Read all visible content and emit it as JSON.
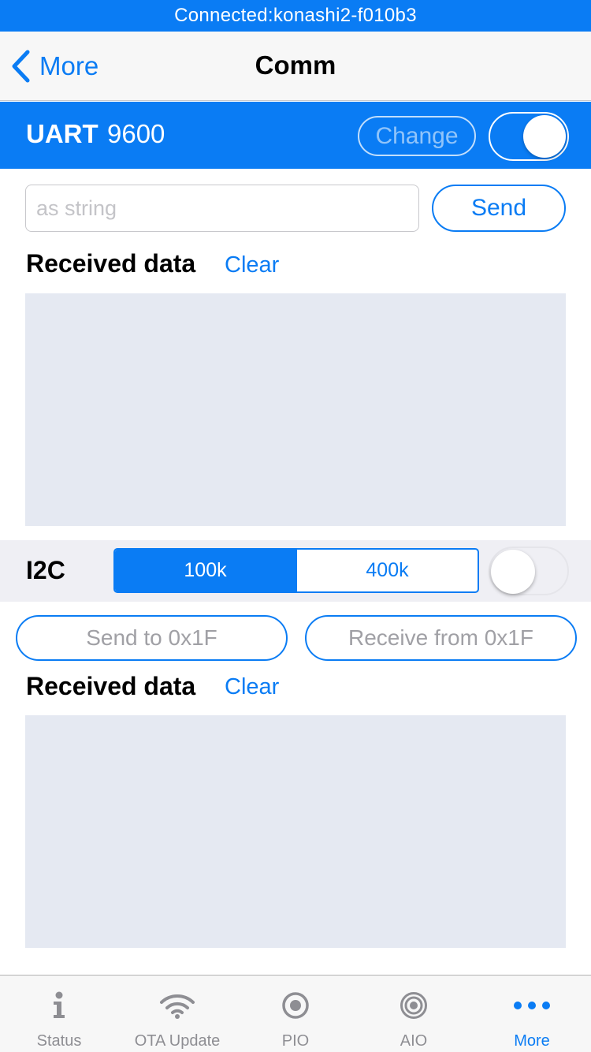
{
  "status_bar": {
    "text": "Connected:konashi2-f010b3"
  },
  "nav": {
    "back_label": "More",
    "title": "Comm"
  },
  "uart": {
    "label": "UART",
    "baud": "9600",
    "change_label": "Change",
    "enabled": true,
    "input_placeholder": "as string",
    "input_value": "",
    "send_label": "Send",
    "received_heading": "Received data",
    "clear_label": "Clear",
    "received_text": ""
  },
  "i2c": {
    "label": "I2C",
    "speeds": [
      "100k",
      "400k"
    ],
    "selected_speed": "100k",
    "enabled": false,
    "send_label": "Send to 0x1F",
    "receive_label": "Receive from 0x1F",
    "received_heading": "Received data",
    "clear_label": "Clear",
    "received_text": ""
  },
  "tabs": [
    {
      "label": "Status",
      "icon": "info-icon",
      "active": false
    },
    {
      "label": "OTA Update",
      "icon": "wifi-icon",
      "active": false
    },
    {
      "label": "PIO",
      "icon": "pio-icon",
      "active": false
    },
    {
      "label": "AIO",
      "icon": "aio-icon",
      "active": false
    },
    {
      "label": "More",
      "icon": "more-icon",
      "active": true
    }
  ],
  "colors": {
    "accent": "#0a7cf4",
    "data_area": "#e5e9f2",
    "section_bg": "#efeff4",
    "inactive": "#8e8e93"
  }
}
